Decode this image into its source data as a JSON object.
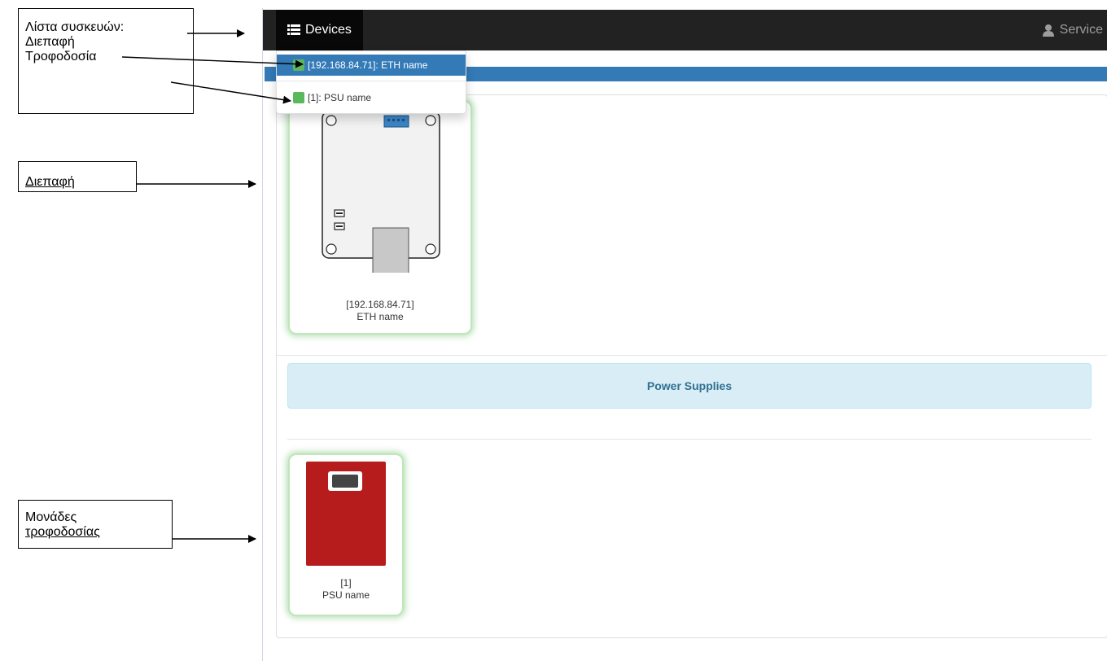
{
  "annotations": {
    "device_list": [
      "Λίστα συσκευών:",
      "Διεπαφή",
      "Τροφοδοσία"
    ],
    "interface": "Διεπαφή",
    "power_units": [
      "Μονάδες",
      "τροφοδοσίας"
    ]
  },
  "navbar": {
    "devices_label": "Devices",
    "devices_icon": "list-icon",
    "service_label": "Service",
    "service_icon": "user-icon"
  },
  "dropdown": {
    "items": [
      {
        "label": "[192.168.84.71]: ETH name",
        "status_color": "#5cb85c",
        "active": true
      },
      {
        "label": "[1]: PSU name",
        "status_color": "#5cb85c",
        "active": false
      }
    ]
  },
  "devices": {
    "interface": {
      "address": "[192.168.84.71]",
      "name": "ETH name"
    },
    "power_supplies_header": "Power Supplies",
    "psu": {
      "address": "[1]",
      "name": "PSU name",
      "color": "#b71c1c"
    }
  },
  "colors": {
    "navbar": "#222222",
    "accent": "#337ab7",
    "status_ok": "#5cb85c",
    "info_bg": "#d9edf7",
    "info_text": "#31708f"
  }
}
